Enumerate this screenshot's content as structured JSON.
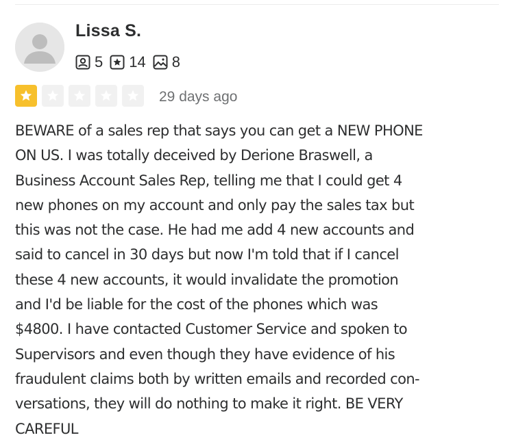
{
  "review": {
    "user": {
      "name": "Lissa S.",
      "friends_count": "5",
      "reviews_count": "14",
      "photos_count": "8"
    },
    "rating": {
      "value": 1,
      "max": 5,
      "filled_color": "#f7c02c",
      "empty_color": "#f1f1f1"
    },
    "date": "29 days ago",
    "text": "BEWARE of a sales rep that says you can get a NEW PHONE\nON US. I was totally deceived by Derione Braswell, a\nBusiness Account Sales Rep, telling me that I could get 4\nnew phones on my account and only pay the sales tax but\nthis was not the case. He had me add 4 new accounts and\nsaid to cancel in 30 days but now I'm told that if I cancel\nthese 4 new accounts, it would invalidate the promotion\nand I'd be liable for the cost of the phones which was\n$4800. I have contacted Customer Service and spoken to\nSupervisors and even though they have evidence of his\nfraudulent claims both by written emails and recorded con-\nversations, they will do nothing to make it right. BE VERY\nCAREFUL"
  },
  "icons": {
    "avatar": "default-user-avatar",
    "friends": "friends-icon",
    "reviews": "review-star-icon",
    "photos": "photo-icon",
    "star": "star-icon"
  }
}
